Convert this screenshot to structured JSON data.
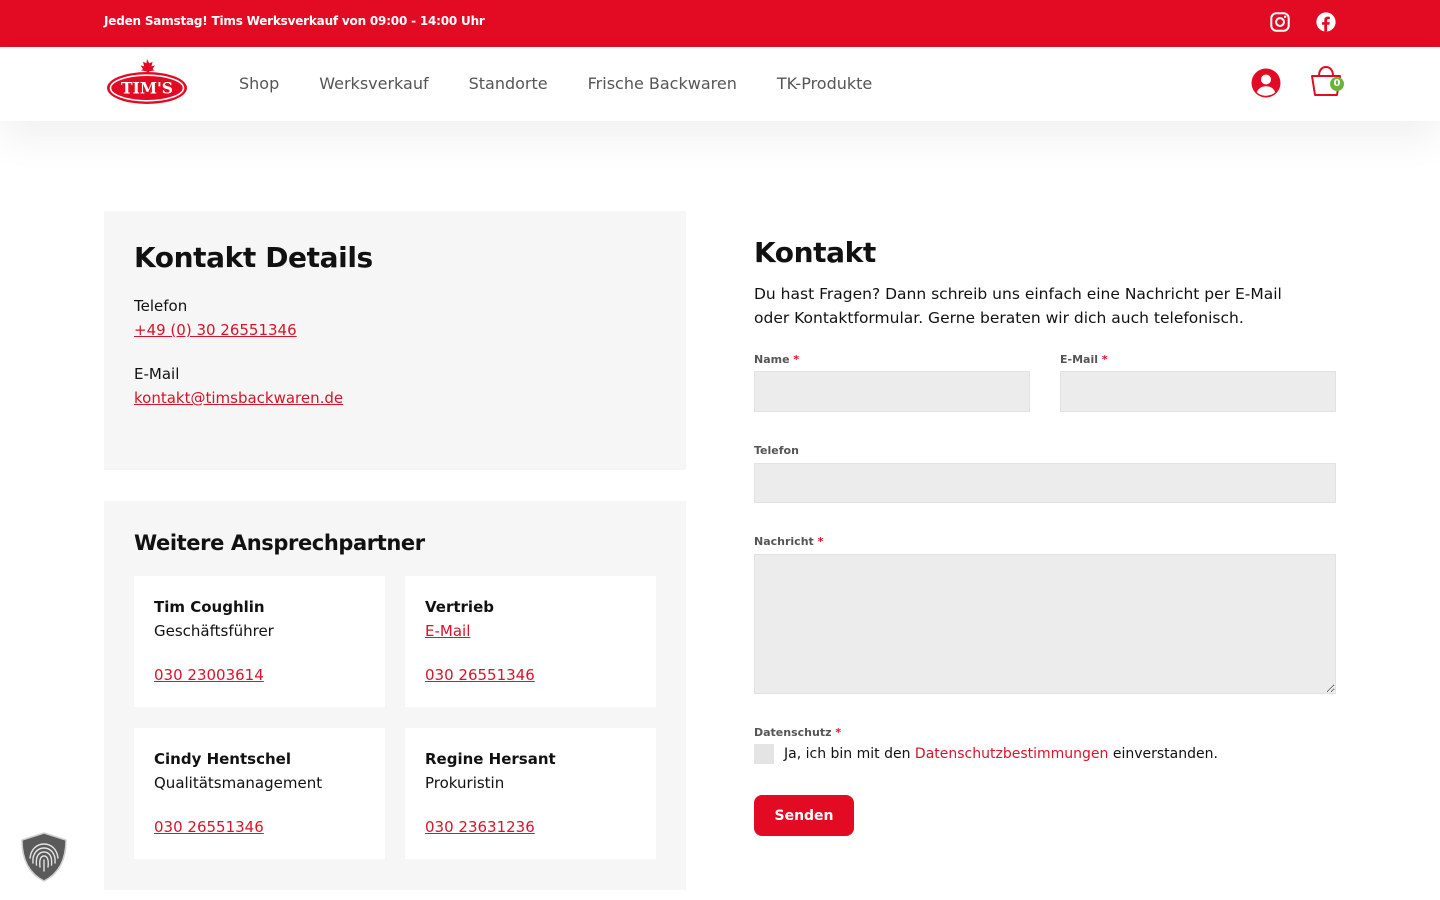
{
  "topbar": {
    "announcement": "Jeden Samstag! Tims Werksverkauf von 09:00 - 14:00 Uhr",
    "background": "#e30b23"
  },
  "social": {
    "icons": [
      "instagram-icon",
      "facebook-icon"
    ]
  },
  "header": {
    "logo_text": "TIM'S",
    "nav": [
      "Shop",
      "Werksverkauf",
      "Standorte",
      "Frische Backwaren",
      "TK-Produkte"
    ],
    "cart_count": "0"
  },
  "contact_details": {
    "title": "Kontakt Details",
    "phone_label": "Telefon",
    "phone": "+49 (0) 30 26551346",
    "email_label": "E-Mail",
    "email": "kontakt@timsbackwaren.de"
  },
  "partners": {
    "title": "Weitere Ansprechpartner",
    "cards": [
      {
        "name": "Tim Coughlin",
        "role": "Geschäftsführer",
        "phone": "030 23003614"
      },
      {
        "name": "Vertrieb",
        "role_link": "E-Mail",
        "phone": "030 26551346"
      },
      {
        "name": "Cindy Hentschel",
        "role": "Qualitätsmanagement",
        "phone": "030 26551346"
      },
      {
        "name": "Regine Hersant",
        "role": "Prokuristin",
        "phone": "030 23631236"
      }
    ]
  },
  "form": {
    "title": "Kontakt",
    "intro_line1": "Du hast Fragen? Dann schreib uns einfach eine Nachricht per E-Mail",
    "intro_line2": "oder Kontaktformular. Gerne beraten wir dich auch telefonisch.",
    "name_label": "Name",
    "email_label": "E-Mail",
    "phone_label": "Telefon",
    "message_label": "Nachricht",
    "privacy_label": "Datenschutz",
    "required_mark": "*",
    "consent_prefix": "Ja, ich bin mit den",
    "consent_link": "Datenschutzbestimmungen",
    "consent_suffix": "einverstanden.",
    "submit_label": "Senden"
  },
  "colors": {
    "accent": "#e30b23",
    "link": "#d8132a",
    "panel": "#f6f6f6",
    "cart_badge": "#6bb43a"
  }
}
